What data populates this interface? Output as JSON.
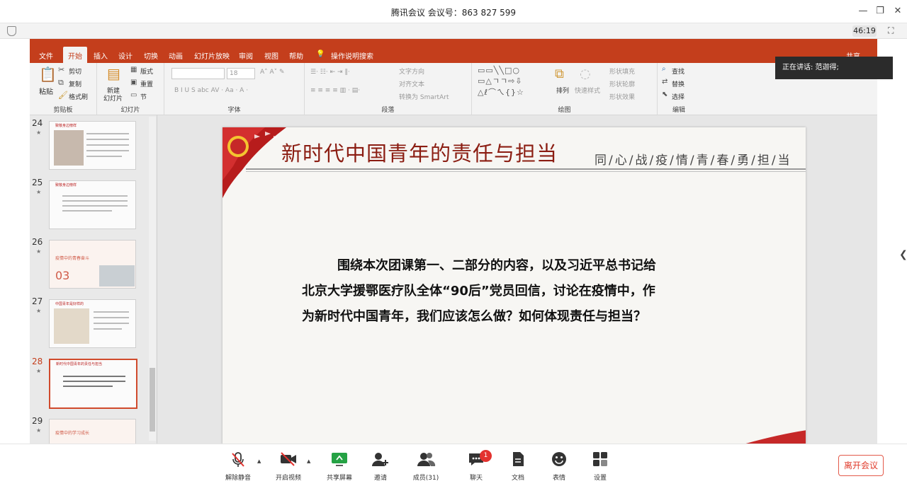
{
  "window": {
    "title": "腾讯会议 会议号：863 827 599",
    "minimize": "—",
    "restore": "❐",
    "close": "✕"
  },
  "meeting_bar": {
    "timer": "46:19",
    "fullscreen_icon": "⛶"
  },
  "speaking_toast": "正在讲话: 范迦得;",
  "ppt": {
    "tabs": [
      "文件",
      "开始",
      "插入",
      "设计",
      "切换",
      "动画",
      "幻灯片放映",
      "审阅",
      "视图",
      "帮助"
    ],
    "active_tab": "开始",
    "tell_me": "操作说明搜索",
    "share": "共享",
    "groups": {
      "clipboard": {
        "label": "剪贴板",
        "paste": "粘贴",
        "cut": "剪切",
        "copy": "复制",
        "format_painter": "格式刷"
      },
      "slides": {
        "label": "幻灯片",
        "new_slide_1": "新建",
        "new_slide_2": "幻灯片",
        "layout": "版式",
        "reset": "重置",
        "section": "节"
      },
      "font": {
        "label": "字体",
        "size": "18"
      },
      "paragraph": {
        "label": "段落",
        "text_direction": "文字方向",
        "align_text": "对齐文本",
        "smartart": "转换为 SmartArt"
      },
      "drawing": {
        "label": "绘图",
        "arrange": "排列",
        "quick_styles": "快速样式",
        "fill": "形状填充",
        "outline": "形状轮廓",
        "effects": "形状效果"
      },
      "editing": {
        "label": "编辑",
        "find": "查找",
        "replace": "替换",
        "select": "选择"
      }
    },
    "thumbnails": [
      {
        "num": "24",
        "title": "致敬身边榜样"
      },
      {
        "num": "25",
        "title": "致敬身边榜样"
      },
      {
        "num": "26",
        "title": "疫情中的青春奋斗",
        "big": "03"
      },
      {
        "num": "27",
        "title": "中国青年是好样的"
      },
      {
        "num": "28",
        "title": "新时代中国青年的责任与担当"
      },
      {
        "num": "29",
        "title": "疫情中的学习成长"
      }
    ],
    "selected_thumbnail": "28",
    "slide": {
      "title": "新时代中国青年的责任与担当",
      "subtitle": "同/心/战/疫/情/青/春/勇/担/当",
      "body": [
        "围绕本次团课第一、二部分的内容，以及习近平总书记给",
        "北京大学援鄂医疗队全体“90后”党员回信，讨论在疫情中，作",
        "为新时代中国青年，我们应该怎么做？如何体现责任与担当？"
      ]
    }
  },
  "toolbar": {
    "buttons": [
      {
        "label": "解除静音",
        "icon": "mic-muted-icon"
      },
      {
        "label": "开启视频",
        "icon": "video-off-icon"
      },
      {
        "label": "共享屏幕",
        "icon": "share-screen-icon"
      },
      {
        "label": "邀请",
        "icon": "invite-icon"
      },
      {
        "label": "成员(31)",
        "icon": "members-icon"
      },
      {
        "label": "聊天",
        "icon": "chat-icon"
      },
      {
        "label": "文档",
        "icon": "document-icon"
      },
      {
        "label": "表情",
        "icon": "emoji-icon"
      },
      {
        "label": "设置",
        "icon": "settings-icon"
      }
    ],
    "chat_badge": "1",
    "leave": "离开会议"
  },
  "colors": {
    "ppt_accent": "#c43e1c",
    "slide_title": "#8b1d12",
    "leave_red": "#e03a2a",
    "share_green": "#25a244"
  }
}
